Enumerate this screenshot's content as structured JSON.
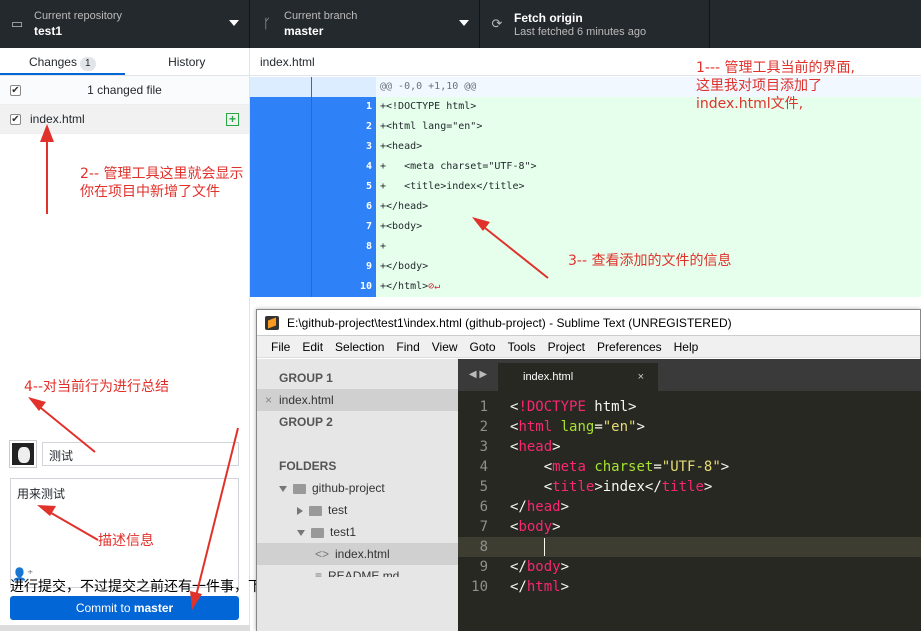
{
  "toolbar": {
    "repo_label": "Current repository",
    "repo_value": "test1",
    "branch_label": "Current branch",
    "branch_value": "master",
    "fetch_title": "Fetch origin",
    "fetch_sub": "Last fetched 6 minutes ago"
  },
  "tabs": {
    "changes": "Changes",
    "changes_count": "1",
    "history": "History"
  },
  "changes": {
    "summary": "1 changed file",
    "file": "index.html"
  },
  "commit": {
    "summary_value": "测试",
    "description": "用来测试",
    "button_prefix": "Commit to ",
    "button_branch": "master"
  },
  "diff": {
    "filename": "index.html",
    "hunk": "@@ -0,0 +1,10 @@",
    "lines": [
      {
        "n": "1",
        "code": "+<!DOCTYPE html>"
      },
      {
        "n": "2",
        "code": "+<html lang=\"en\">"
      },
      {
        "n": "3",
        "code": "+<head>"
      },
      {
        "n": "4",
        "code": "+   <meta charset=\"UTF-8\">"
      },
      {
        "n": "5",
        "code": "+   <title>index</title>"
      },
      {
        "n": "6",
        "code": "+</head>"
      },
      {
        "n": "7",
        "code": "+<body>"
      },
      {
        "n": "8",
        "code": "+"
      },
      {
        "n": "9",
        "code": "+</body>"
      },
      {
        "n": "10",
        "code": "+</html>"
      }
    ]
  },
  "sublime": {
    "title": "E:\\github-project\\test1\\index.html (github-project) - Sublime Text (UNREGISTERED)",
    "menu": [
      "File",
      "Edit",
      "Selection",
      "Find",
      "View",
      "Goto",
      "Tools",
      "Project",
      "Preferences",
      "Help"
    ],
    "group1": "GROUP 1",
    "open_file": "index.html",
    "group2": "GROUP 2",
    "folders": "FOLDERS",
    "tree": [
      "github-project",
      "test",
      "test1",
      "index.html",
      "README.md"
    ],
    "tab": "index.html",
    "line_numbers": [
      "1",
      "2",
      "3",
      "4",
      "5",
      "6",
      "7",
      "8",
      "9",
      "10"
    ]
  },
  "annotations": {
    "note1_l1": "1--- 管理工具当前的界面,",
    "note1_l2": "这里我对项目添加了",
    "note1_l3": "index.html文件,",
    "note2_l1": "2-- 管理工具这里就会显示",
    "note2_l2": "你在项目中新增了文件",
    "note3": "3-- 查看添加的文件的信息",
    "note4": "4--对当前行为进行总结",
    "note5": "描述信息",
    "overlay": "进行提交，不过提交之前还有一件事，下一张图进行描述"
  }
}
